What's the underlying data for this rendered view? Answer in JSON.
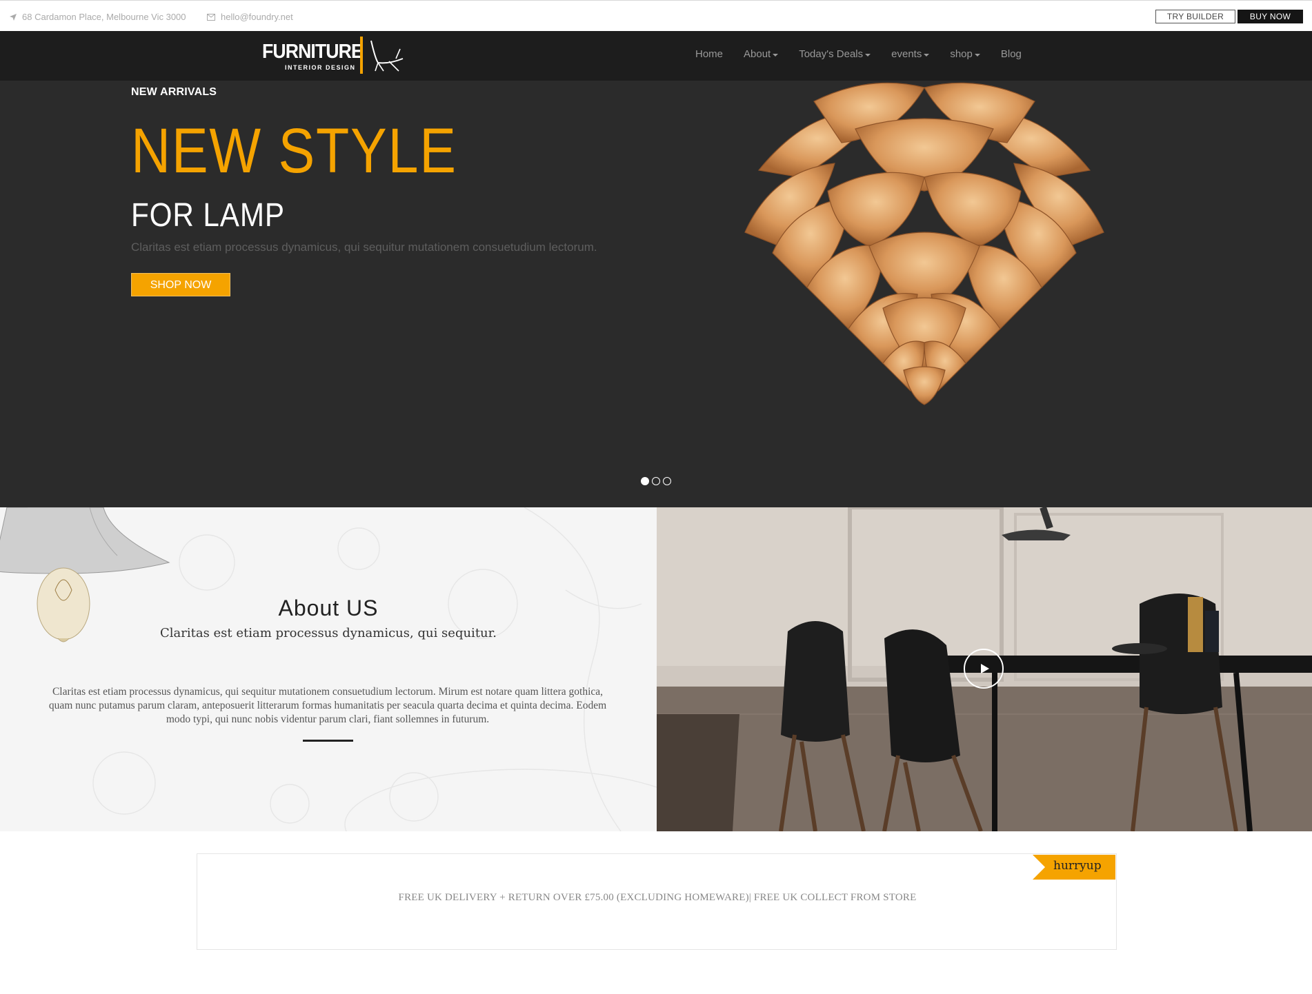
{
  "topbar": {
    "address": "68 Cardamon Place, Melbourne Vic 3000",
    "email": "hello@foundry.net",
    "try_builder": "TRY BUILDER",
    "buy_now": "BUY NOW"
  },
  "brand": {
    "name": "FURNITURE",
    "tagline": "INTERIOR DESIGN",
    "accent": "#f5a300"
  },
  "nav": {
    "items": [
      {
        "label": "Home"
      },
      {
        "label": "About"
      },
      {
        "label": "Today's Deals"
      },
      {
        "label": "events"
      },
      {
        "label": "shop"
      },
      {
        "label": "Blog"
      }
    ]
  },
  "hero": {
    "eyebrow": "NEW ARRIVALS",
    "title": "NEW STYLE",
    "subtitle": "FOR LAMP",
    "description": "Claritas est etiam processus dynamicus, qui sequitur mutationem consuetudium lectorum.",
    "cta": "SHOP NOW",
    "slides": 3,
    "active_slide": 1
  },
  "about": {
    "heading": "About US",
    "lead": "Claritas est etiam processus dynamicus, qui sequitur.",
    "body": "Claritas est etiam processus dynamicus, qui sequitur mutationem consuetudium lectorum. Mirum est notare quam littera gothica, quam nunc putamus parum claram, anteposuerit litterarum formas humanitatis per seacula quarta decima et quinta decima. Eodem modo typi, qui nunc nobis videntur parum clari, fiant sollemnes in futurum."
  },
  "promo": {
    "ribbon": "hurryup",
    "text": "FREE UK DELIVERY + RETURN OVER  £75.00 (EXCLUDING HOMEWARE)| FREE UK COLLECT FROM STORE"
  }
}
